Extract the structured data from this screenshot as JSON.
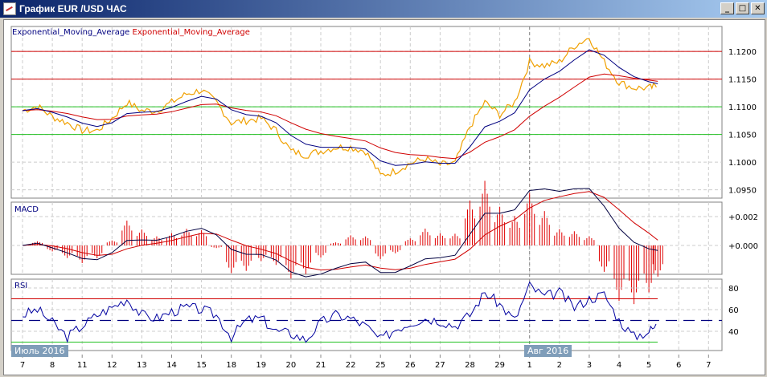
{
  "window": {
    "title": "График EUR /USD  ЧАС",
    "minimize": "_",
    "maximize": "□",
    "close": "✕"
  },
  "legend": {
    "ema_fast": "Exponential_Moving_Average",
    "ema_slow": "Exponential_Moving_Average"
  },
  "colors": {
    "price": "#f0a000",
    "ema_fast": "#000080",
    "ema_slow": "#d00000",
    "level_red": "#d00000",
    "level_green": "#20c020",
    "rsi": "#0000a0",
    "rsi_over": "#e000e0",
    "rsi_under": "#20c020"
  },
  "months": [
    "Июль 2016",
    "Авг 2016"
  ],
  "chart_data": [
    {
      "type": "line",
      "title": "EUR/USD ЧАС",
      "ylim": [
        1.0935,
        1.1245
      ],
      "yticks": [
        "1.1200",
        "1.1150",
        "1.1100",
        "1.1050",
        "1.1000",
        "1.0950"
      ],
      "levels_red": [
        1.12,
        1.115
      ],
      "levels_green": [
        1.11,
        1.105
      ],
      "xlabels": [
        "7",
        "8",
        "11",
        "12",
        "13",
        "14",
        "15",
        "18",
        "19",
        "20",
        "21",
        "22",
        "25",
        "26",
        "27",
        "28",
        "29",
        "1",
        "2",
        "3",
        "4",
        "5",
        "6",
        "7"
      ],
      "x": [
        0,
        0.5,
        1,
        1.5,
        2,
        2.5,
        3,
        3.5,
        4,
        4.5,
        5,
        5.5,
        6,
        6.5,
        7,
        7.5,
        8,
        8.5,
        9,
        9.5,
        10,
        10.5,
        11,
        11.5,
        12,
        12.5,
        13,
        13.5,
        14,
        14.5,
        15,
        15.5,
        16,
        16.5,
        17,
        17.5,
        18,
        18.5,
        19,
        19.5,
        20,
        20.5,
        21,
        21.3
      ],
      "price": [
        1.1093,
        1.1101,
        1.1082,
        1.1071,
        1.1057,
        1.1057,
        1.1079,
        1.1108,
        1.1093,
        1.1093,
        1.1108,
        1.1123,
        1.113,
        1.1108,
        1.1071,
        1.1075,
        1.1079,
        1.1057,
        1.102,
        1.1013,
        1.102,
        1.1027,
        1.1027,
        1.102,
        1.0976,
        1.0984,
        1.0998,
        1.1006,
        1.0995,
        1.0998,
        1.1064,
        1.1108,
        1.1086,
        1.1108,
        1.1181,
        1.1174,
        1.1181,
        1.121,
        1.1225,
        1.1181,
        1.1144,
        1.1134,
        1.1134,
        1.1137
      ]
    },
    {
      "type": "line",
      "title": "MACD",
      "yticks": [
        "+0.002",
        "+0.000"
      ],
      "ylim": [
        -0.0018,
        0.0025
      ]
    },
    {
      "type": "line",
      "title": "RSI",
      "yticks": [
        "80",
        "60",
        "40"
      ],
      "ylim": [
        22,
        86
      ],
      "levels": [
        70,
        50,
        30
      ],
      "rsi": [
        55,
        60,
        48,
        35,
        45,
        55,
        62,
        70,
        55,
        52,
        58,
        62,
        60,
        55,
        35,
        50,
        52,
        40,
        38,
        32,
        48,
        55,
        52,
        45,
        32,
        42,
        48,
        52,
        50,
        45,
        55,
        76,
        65,
        50,
        82,
        72,
        76,
        62,
        70,
        74,
        50,
        35,
        40,
        46
      ]
    }
  ]
}
